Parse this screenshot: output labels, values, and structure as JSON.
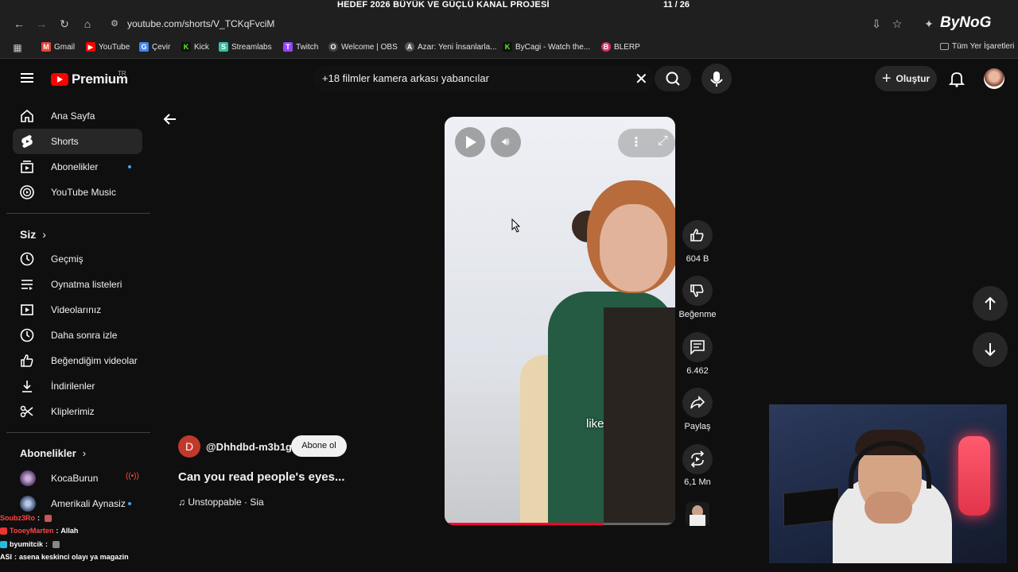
{
  "overlay": {
    "title": "HEDEF 2026 BÜYÜK VE GÜÇLÜ KANAL PROJESİ",
    "count": "11 / 26",
    "progress": 0.42
  },
  "browser": {
    "url": "youtube.com/shorts/V_TCKqFvciM",
    "brand": "ByNoG",
    "bookmarks": [
      "Gmail",
      "YouTube",
      "Çevir",
      "Kick",
      "Streamlabs",
      "Twitch",
      "Welcome | OBS",
      "Azar: Yeni İnsanlarla...",
      "ByCagi - Watch the...",
      "BLERP"
    ],
    "all_bookmarks": "Tüm Yer İşaretleri"
  },
  "header": {
    "logo": "Premium",
    "region": "TR",
    "search_value": "+18 filmler kamera arkası yabancılar",
    "create_label": "Oluştur"
  },
  "sidebar": {
    "main": [
      {
        "label": "Ana Sayfa",
        "icon": "home-icon"
      },
      {
        "label": "Shorts",
        "icon": "shorts-icon"
      },
      {
        "label": "Abonelikler",
        "icon": "subscriptions-icon"
      },
      {
        "label": "YouTube Music",
        "icon": "music-icon"
      }
    ],
    "you_header": "Siz",
    "you": [
      {
        "label": "Geçmiş",
        "icon": "history-icon"
      },
      {
        "label": "Oynatma listeleri",
        "icon": "playlists-icon"
      },
      {
        "label": "Videolarınız",
        "icon": "your-videos-icon"
      },
      {
        "label": "Daha sonra izle",
        "icon": "watch-later-icon"
      },
      {
        "label": "Beğendiğim videolar",
        "icon": "liked-icon"
      },
      {
        "label": "İndirilenler",
        "icon": "downloads-icon"
      },
      {
        "label": "Kliplerimiz",
        "icon": "clips-icon"
      }
    ],
    "subs_header": "Abonelikler",
    "subs": [
      {
        "label": "KocaBurun"
      },
      {
        "label": "Amerikali Aynasiz"
      }
    ]
  },
  "short": {
    "caption": "like",
    "progress": 0.69,
    "channel_initial": "D",
    "channel": "@Dhhdbd-m3b1g",
    "subscribe_label": "Abone ol",
    "title": "Can you read people's eyes...",
    "music": "♫ Unstoppable · Sia"
  },
  "actions": {
    "likes": "604 B",
    "dislike": "Beğenme",
    "comments": "6.462",
    "share": "Paylaş",
    "remix": "6,1 Mn"
  },
  "chat": [
    {
      "user": "Soubz3Ro",
      "text": "",
      "color": "#ff4545"
    },
    {
      "user": "TooeyMarten",
      "text": "Allah",
      "color": "#ff4545"
    },
    {
      "user": "byumitcik",
      "text": "",
      "color": "#ffffff"
    },
    {
      "user": "ASI",
      "text": "asena keskinci olayı ya magazin",
      "color": "#ffffff"
    }
  ],
  "colors": {
    "accent": "#ff0000",
    "bg": "#0f0f0f",
    "chip": "#272727",
    "overlay_border": "#dd1111"
  }
}
